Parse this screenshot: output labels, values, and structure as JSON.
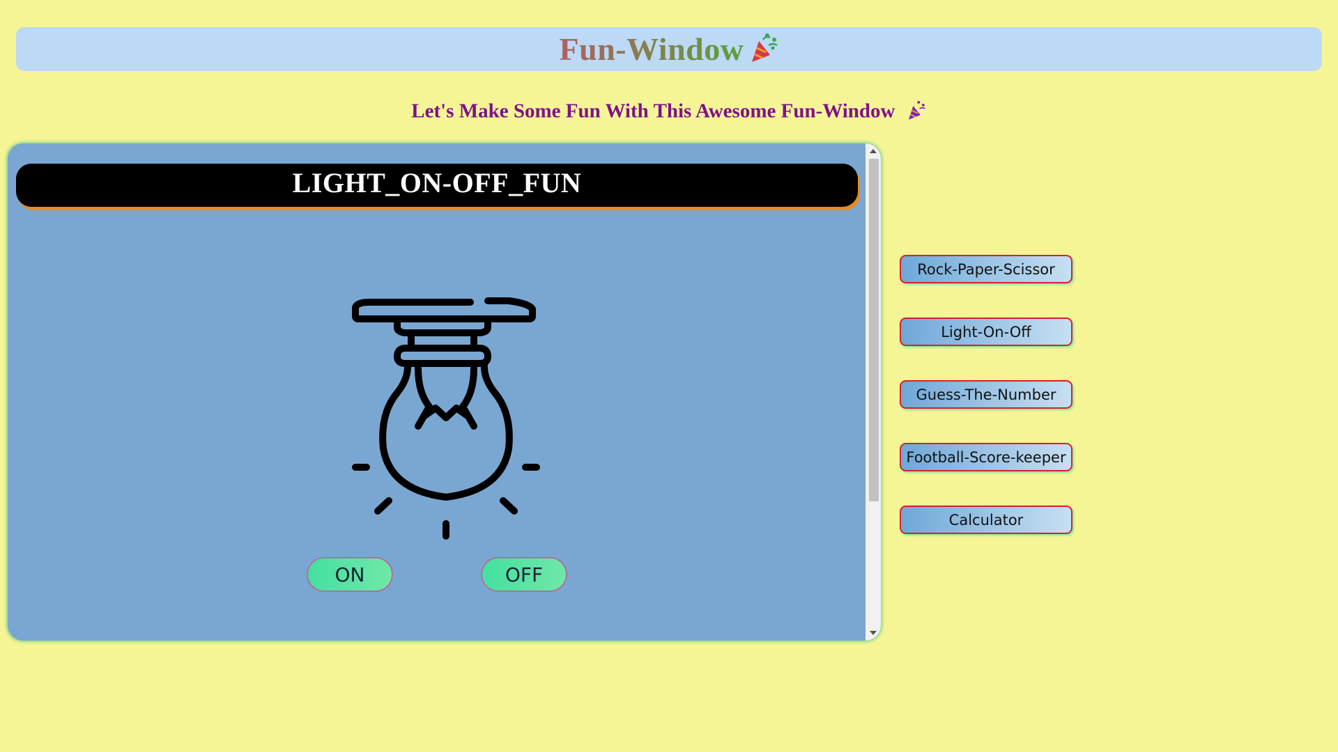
{
  "header": {
    "title": "Fun-Window",
    "emoji": "🎉"
  },
  "subtitle": {
    "text": "Let's Make Some Fun With This Awesome Fun-Window",
    "emoji": "🎉"
  },
  "game_panel": {
    "title": "LIGHT_ON-OFF_FUN",
    "bulb_icon": "light-bulb-icon",
    "on_label": "ON",
    "off_label": "OFF"
  },
  "nav": {
    "items": [
      {
        "label": "Rock-Paper-Scissor"
      },
      {
        "label": "Light-On-Off"
      },
      {
        "label": "Guess-The-Number"
      },
      {
        "label": "Football-Score-keeper"
      },
      {
        "label": "Calculator"
      }
    ]
  },
  "colors": {
    "page_bg": "#f5f596",
    "header_bg": "#bcd9f5",
    "subtitle": "#80108a",
    "panel_bg": "#7aa7d2",
    "title_bar": "#000000",
    "title_bar_shadow": "#e88a1d",
    "nav_border": "#d8202a",
    "toggle_green": "#44e0a0"
  }
}
